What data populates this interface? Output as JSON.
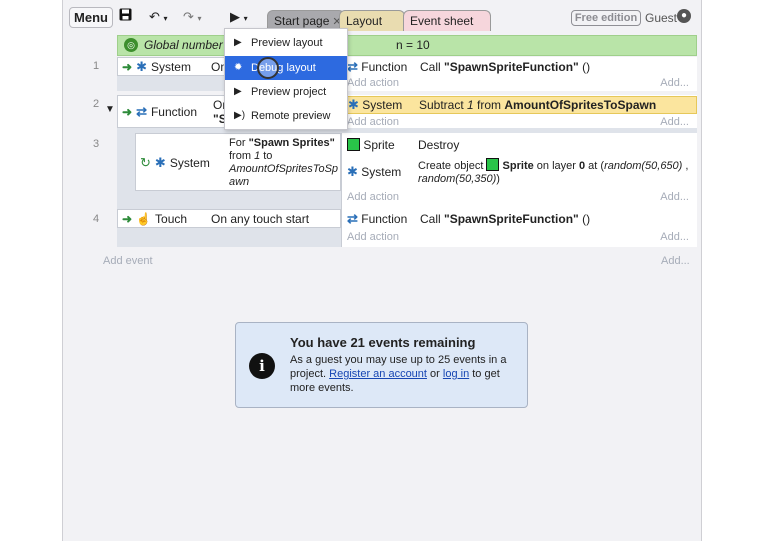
{
  "toolbar": {
    "menu_label": "Menu",
    "save_icon": "save-icon",
    "undo_icon": "undo-icon",
    "redo_icon": "redo-icon",
    "play_icon": "play-icon",
    "tabs": [
      {
        "label": "Start page",
        "closable": true
      },
      {
        "label": "Layout 1",
        "closable": true
      },
      {
        "label": "Event sheet 1",
        "closable": true
      }
    ],
    "free_edition_label": "Free edition",
    "guest_label": "Guest"
  },
  "preview_menu": {
    "items": [
      {
        "label": "Preview layout",
        "icon": "play-icon"
      },
      {
        "label": "Debug layout",
        "icon": "bug-icon",
        "active": true
      },
      {
        "label": "Preview project",
        "icon": "play-icon"
      },
      {
        "label": "Remote preview",
        "icon": "broadcast-icon"
      }
    ]
  },
  "event_sheet": {
    "global_var": {
      "prefix": "Global number A",
      "suffix": "n = 10"
    },
    "events": [
      {
        "number": "1",
        "condition_object": "System",
        "condition_text": "On",
        "actions": [
          {
            "object": "Function",
            "text_prefix": "Call ",
            "text_bold": "\"SpawnSpriteFunction\"",
            "text_suffix": " ()"
          }
        ],
        "add_action": "Add action",
        "add_more": "Add..."
      },
      {
        "number": "2",
        "condition_object": "Function",
        "condition_text_1": "Or",
        "condition_text_2": "\"S",
        "actions": [
          {
            "object": "System",
            "text_prefix": "Subtract ",
            "text_italic": "1",
            "text_mid": " from ",
            "text_bold": "AmountOfSpritesToSpawn"
          }
        ],
        "add_action": "Add action",
        "add_more": "Add..."
      },
      {
        "number": "3",
        "condition_object": "System",
        "loop_prefix": "For ",
        "loop_name": "\"Spawn Sprites\"",
        "loop_from": "from ",
        "loop_from_value": "1",
        "loop_to": " to",
        "loop_var": "AmountOfSpritesToSpawn",
        "actions": [
          {
            "object": "Sprite",
            "text": "Destroy"
          },
          {
            "object": "System",
            "create_prefix": "Create object ",
            "create_object": "Sprite",
            "create_mid": " on layer ",
            "create_layer": "0",
            "create_at": " at (",
            "create_x": "random(50,650)",
            "create_comma": " ,",
            "create_y": "random(50,350)",
            "create_close": ")"
          }
        ],
        "add_action": "Add action",
        "add_more": "Add..."
      },
      {
        "number": "4",
        "condition_object": "Touch",
        "condition_text": "On any touch start",
        "actions": [
          {
            "object": "Function",
            "text_prefix": "Call ",
            "text_bold": "\"SpawnSpriteFunction\"",
            "text_suffix": " ()"
          }
        ],
        "add_action": "Add action",
        "add_more": "Add..."
      }
    ],
    "add_event": "Add event",
    "add_event_more": "Add..."
  },
  "notice": {
    "title": "You have 21 events remaining",
    "body_1": "As a guest you may use up to 25 events in a project. ",
    "register_link": "Register an account",
    "body_2": " or ",
    "login_link": "log in",
    "body_3": " to get more events."
  }
}
